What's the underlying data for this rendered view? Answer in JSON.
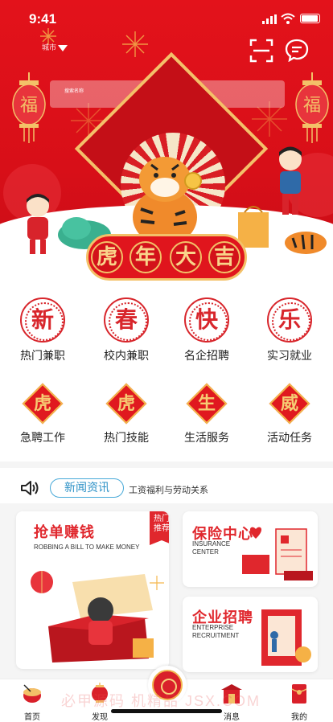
{
  "status_bar": {
    "time": "9:41"
  },
  "header": {
    "location_text": "城市",
    "search_placeholder": "搜索名称"
  },
  "banner": {
    "chars": [
      "虎",
      "年",
      "大",
      "吉"
    ]
  },
  "grid_row1": [
    {
      "icon": "新",
      "label": "热门兼职"
    },
    {
      "icon": "春",
      "label": "校内兼职"
    },
    {
      "icon": "快",
      "label": "名企招聘"
    },
    {
      "icon": "乐",
      "label": "实习就业"
    }
  ],
  "grid_row2": [
    {
      "icon": "虎",
      "label": "急聘工作"
    },
    {
      "icon": "虎",
      "label": "热门技能"
    },
    {
      "icon": "生",
      "label": "生活服务"
    },
    {
      "icon": "威",
      "label": "活动任务"
    }
  ],
  "news": {
    "tag": "新闻资讯",
    "headline": "工资福利与劳动关系"
  },
  "cards": {
    "grab": {
      "title": "抢单赚钱",
      "subtitle": "ROBBING A BILL TO MAKE MONEY",
      "hot_line1": "热门",
      "hot_line2": "推荐"
    },
    "insurance": {
      "title": "保险中心",
      "subtitle_line1": "INSURANCE",
      "subtitle_line2": "CENTER"
    },
    "enterprise": {
      "title": "企业招聘",
      "subtitle_line1": "ENTERPRISE",
      "subtitle_line2": "RECRUITMENT"
    }
  },
  "tabbar": {
    "tabs": [
      "首页",
      "发现",
      "消息",
      "我的"
    ]
  },
  "watermark": "必甲源码 机精品 JSX.COM",
  "colors": {
    "brand_red": "#e0151d",
    "gold": "#f3c168",
    "news_blue": "#48a9d8"
  }
}
